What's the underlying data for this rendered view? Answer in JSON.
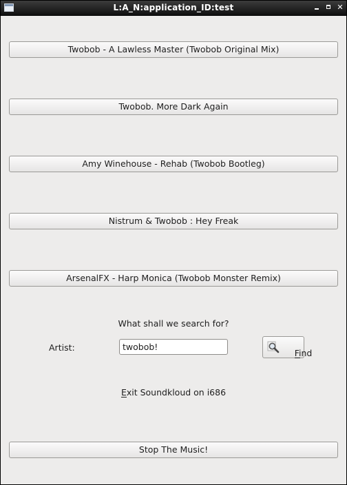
{
  "window": {
    "title": "L:A_N:application_ID:test",
    "controls": {
      "minimize": "minimize",
      "maximize": "maximize",
      "close": "✕"
    }
  },
  "tracks": [
    {
      "label": "Twobob - A Lawless Master (Twobob Original Mix)"
    },
    {
      "label": "Twobob. More Dark Again"
    },
    {
      "label": "Amy Winehouse - Rehab (Twobob Bootleg)"
    },
    {
      "label": "Nistrum & Twobob : Hey Freak"
    },
    {
      "label": "ArsenalFX - Harp Monica (Twobob Monster Remix)"
    }
  ],
  "search": {
    "prompt": "What shall we search for?",
    "artist_label": "Artist:",
    "artist_value": "twobob!",
    "find_label": "Find",
    "find_icon": "magnifier-icon"
  },
  "exit_label": "Exit Soundkloud on i686",
  "stop_label": "Stop The Music!"
}
